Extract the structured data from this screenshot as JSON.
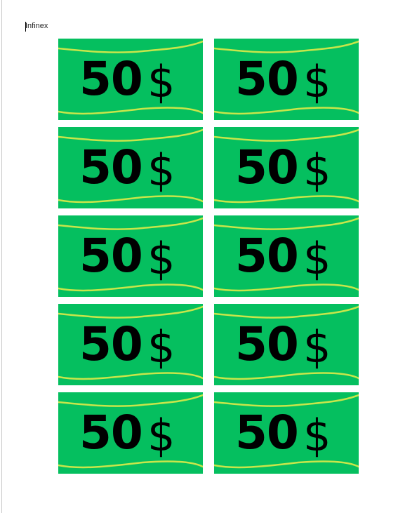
{
  "document": {
    "header_text": "Infinex"
  },
  "bills": [
    {
      "amount": "50",
      "currency": "$"
    },
    {
      "amount": "50",
      "currency": "$"
    },
    {
      "amount": "50",
      "currency": "$"
    },
    {
      "amount": "50",
      "currency": "$"
    },
    {
      "amount": "50",
      "currency": "$"
    },
    {
      "amount": "50",
      "currency": "$"
    },
    {
      "amount": "50",
      "currency": "$"
    },
    {
      "amount": "50",
      "currency": "$"
    },
    {
      "amount": "50",
      "currency": "$"
    },
    {
      "amount": "50",
      "currency": "$"
    }
  ],
  "colors": {
    "bill_bg": "#05bf5f",
    "bill_line": "#c8e64a",
    "text": "#000000"
  }
}
